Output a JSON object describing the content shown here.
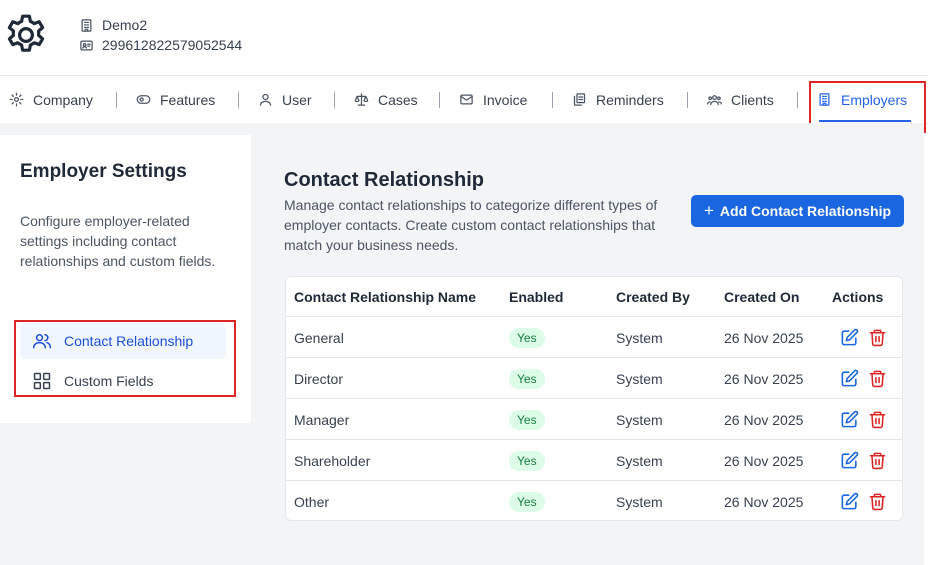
{
  "org": {
    "name": "Demo2",
    "id": "299612822579052544"
  },
  "tabs": [
    {
      "label": "Company",
      "icon": "gear-icon"
    },
    {
      "label": "Features",
      "icon": "eye-icon"
    },
    {
      "label": "User",
      "icon": "user-icon"
    },
    {
      "label": "Cases",
      "icon": "scale-icon"
    },
    {
      "label": "Invoice",
      "icon": "mail-icon"
    },
    {
      "label": "Reminders",
      "icon": "clipboard-icon"
    },
    {
      "label": "Clients",
      "icon": "users-icon"
    },
    {
      "label": "Employers",
      "icon": "building-icon",
      "active": true
    }
  ],
  "sidebar": {
    "title": "Employer Settings",
    "description": "Configure employer-related settings including contact relationships and custom fields.",
    "items": [
      {
        "label": "Contact Relationship",
        "icon": "users-icon",
        "active": true
      },
      {
        "label": "Custom Fields",
        "icon": "grid-icon",
        "active": false
      }
    ]
  },
  "main": {
    "title": "Contact Relationship",
    "description": "Manage contact relationships to categorize different types of employer contacts. Create custom contact relationships that match your business needs.",
    "add_button": "Add Contact Relationship",
    "columns": [
      "Contact Relationship Name",
      "Enabled",
      "Created By",
      "Created On",
      "Actions"
    ],
    "rows": [
      {
        "name": "General",
        "enabled": "Yes",
        "created_by": "System",
        "created_on": "26 Nov 2025"
      },
      {
        "name": "Director",
        "enabled": "Yes",
        "created_by": "System",
        "created_on": "26 Nov 2025"
      },
      {
        "name": "Manager",
        "enabled": "Yes",
        "created_by": "System",
        "created_on": "26 Nov 2025"
      },
      {
        "name": "Shareholder",
        "enabled": "Yes",
        "created_by": "System",
        "created_on": "26 Nov 2025"
      },
      {
        "name": "Other",
        "enabled": "Yes",
        "created_by": "System",
        "created_on": "26 Nov 2025"
      }
    ]
  },
  "colors": {
    "accent": "#1a66e0",
    "highlight": "#dc2626",
    "badge_bg": "#dcfce7",
    "badge_text": "#15803d",
    "delete": "#dc2626"
  }
}
